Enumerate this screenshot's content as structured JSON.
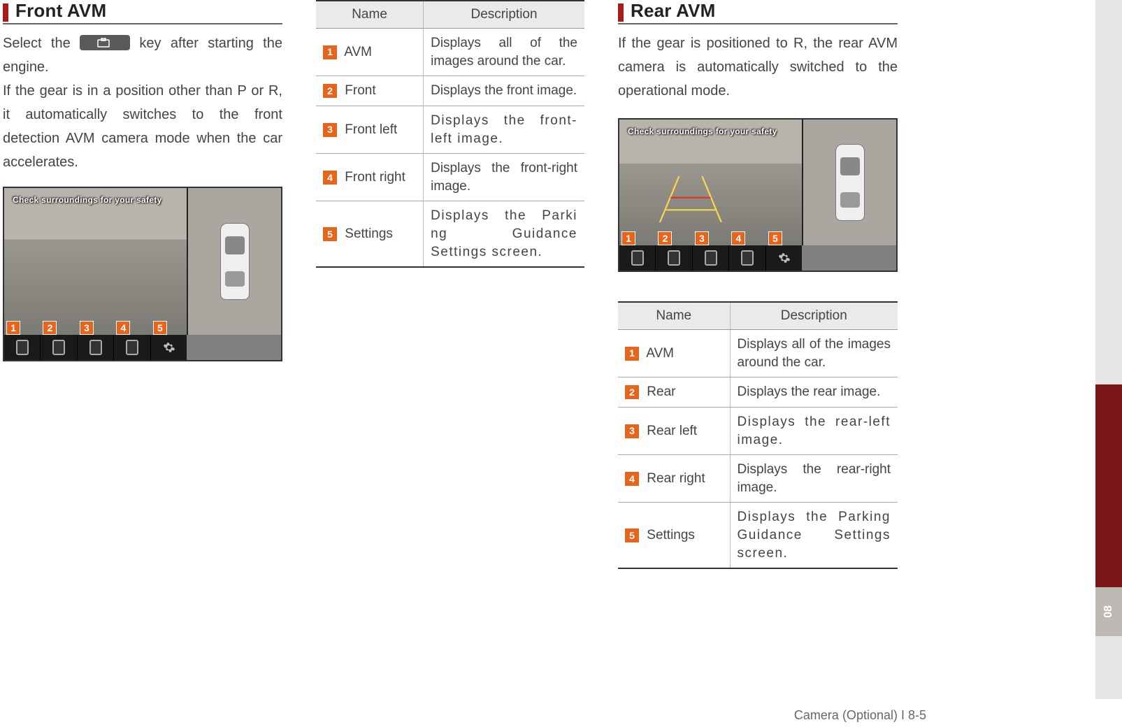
{
  "front": {
    "title": "Front AVM",
    "para1a": "Select the ",
    "para1b": " key after starting the engine.",
    "para2": "If the gear is in a position other than P or R, it automatically switches to the front detection AVM camera mode when the car accelerates.",
    "overlay": "Check surroundings for your safety"
  },
  "frontTable": {
    "headers": {
      "name": "Name",
      "desc": "Description"
    },
    "rows": [
      {
        "num": "1",
        "name": "AVM",
        "desc": "Displays all of the images around the car."
      },
      {
        "num": "2",
        "name": "Front",
        "desc": "Displays the front image."
      },
      {
        "num": "3",
        "name": "Front left",
        "desc": "Displays the front-left image.",
        "stretch": true
      },
      {
        "num": "4",
        "name": "Front right",
        "desc": "Displays the front-right image."
      },
      {
        "num": "5",
        "name": "Settings",
        "desc": "Displays the Parki ng Guidance Settings screen.",
        "stretch": true
      }
    ]
  },
  "rear": {
    "title": "Rear AVM",
    "para1": "If the gear is positioned to R, the rear AVM camera is automatically switched to the operational mode.",
    "overlay": "Check surroundings for your safety"
  },
  "rearTable": {
    "headers": {
      "name": "Name",
      "desc": "Description"
    },
    "rows": [
      {
        "num": "1",
        "name": "AVM",
        "desc": "Displays all of the images around the car."
      },
      {
        "num": "2",
        "name": "Rear",
        "desc": "Displays the rear image."
      },
      {
        "num": "3",
        "name": "Rear left",
        "desc": "Displays the rear-left image.",
        "stretch": true
      },
      {
        "num": "4",
        "name": "Rear right",
        "desc": "Displays the rear-right image."
      },
      {
        "num": "5",
        "name": "Settings",
        "desc": "Displays the Parking Guidance Settings screen.",
        "stretch": true
      }
    ]
  },
  "buttons": [
    "1",
    "2",
    "3",
    "4",
    "5"
  ],
  "sideTab": "08",
  "footer": "Camera (Optional) I 8-5"
}
